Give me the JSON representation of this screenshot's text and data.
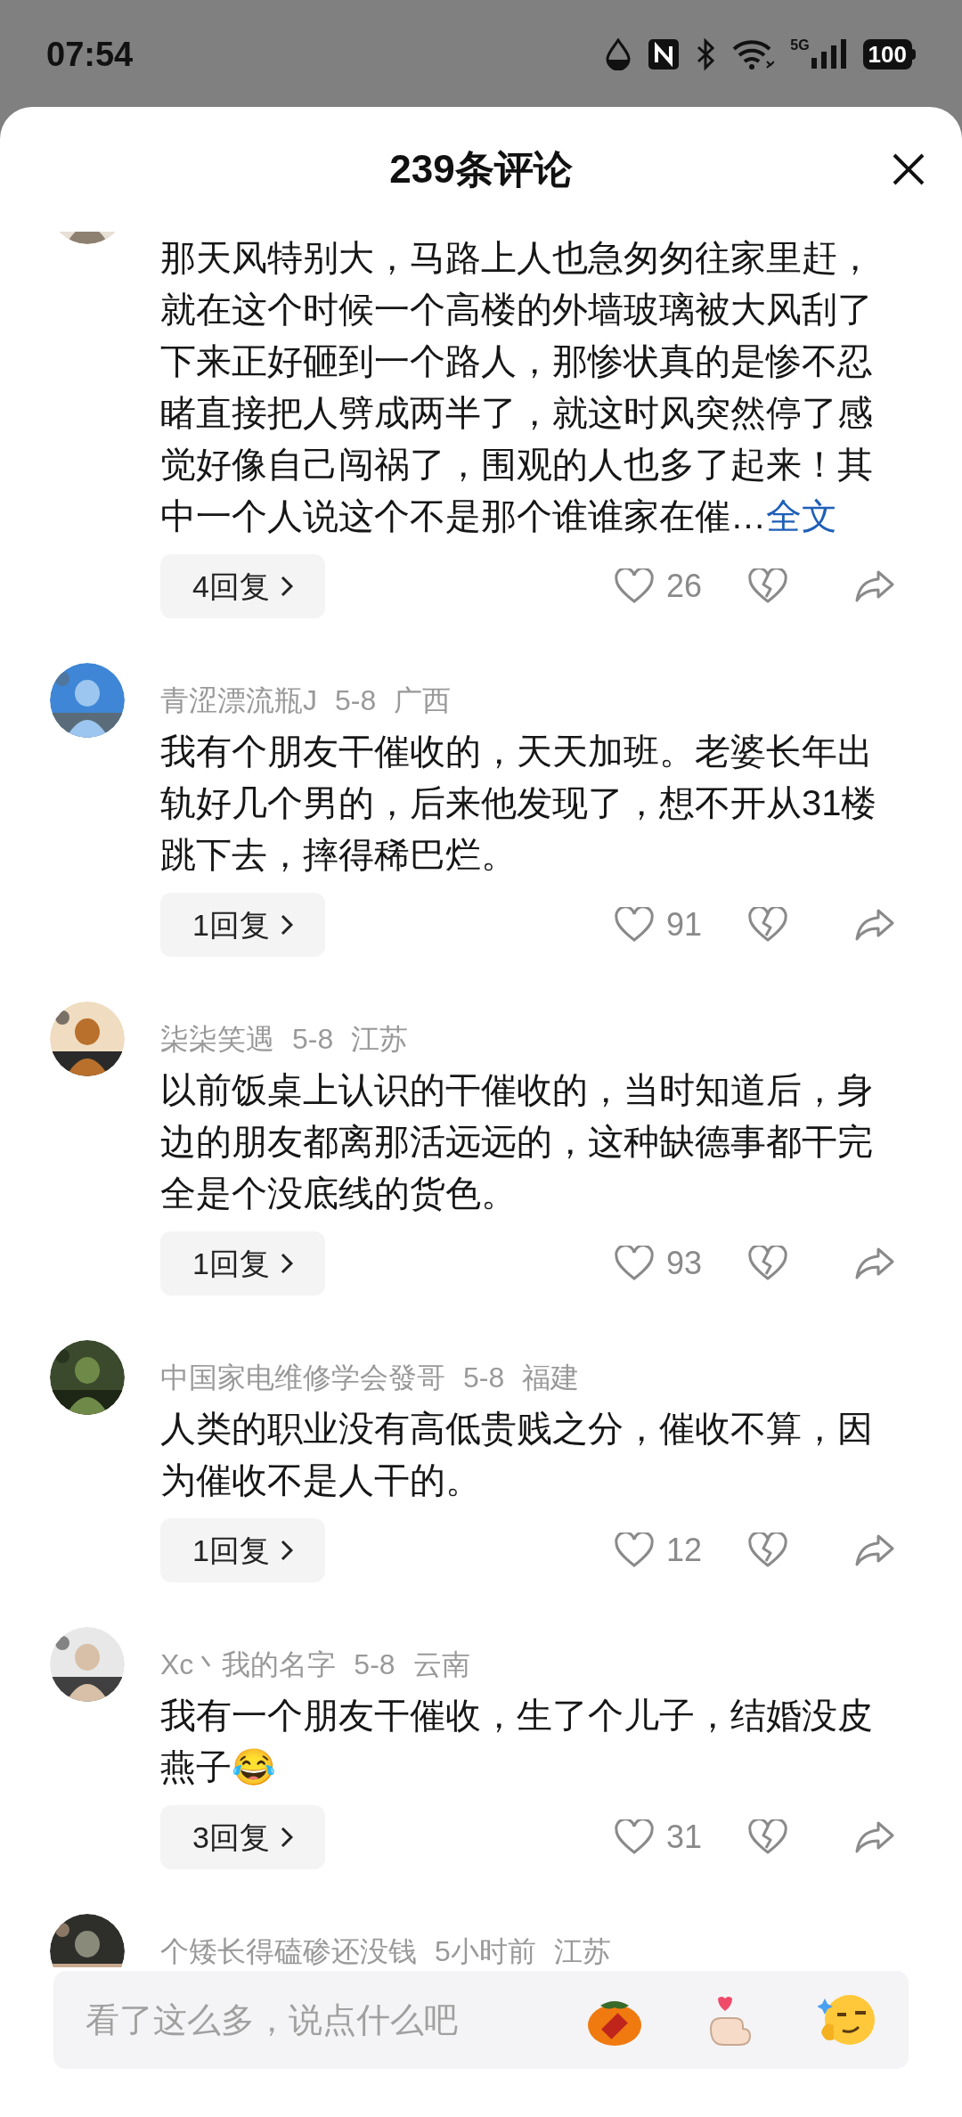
{
  "status_bar": {
    "time": "07:54",
    "network": "5G",
    "battery": "100"
  },
  "header": {
    "title": "239条评论"
  },
  "comments": [
    {
      "text": "那天风特别大，马路上人也急匆匆往家里赶，就在这个时候一个高楼的外墙玻璃被大风刮了下来正好砸到一个路人，那惨状真的是惨不忍睹直接把人劈成两半了，就这时风突然停了感觉好像自己闯祸了，围观的人也多了起来！其中一个人说这个不是那个谁谁家在催…",
      "more_link": "全文",
      "replies": "4回复",
      "likes": "26"
    },
    {
      "author": "青涩漂流瓶J",
      "date": "5-8",
      "region": "广西",
      "text": "我有个朋友干催收的，天天加班。老婆长年出轨好几个男的，后来他发现了，想不开从31楼跳下去，摔得稀巴烂。",
      "replies": "1回复",
      "likes": "91"
    },
    {
      "author": "柒柒笑遇",
      "date": "5-8",
      "region": "江苏",
      "text": "以前饭桌上认识的干催收的，当时知道后，身边的朋友都离那活远远的，这种缺德事都干完全是个没底线的货色。",
      "replies": "1回复",
      "likes": "93"
    },
    {
      "author": "中国家电维修学会發哥",
      "date": "5-8",
      "region": "福建",
      "text": "人类的职业没有高低贵贱之分，催收不算，因为催收不是人干的。",
      "replies": "1回复",
      "likes": "12"
    },
    {
      "author": "Xc丶我的名字",
      "date": "5-8",
      "region": "云南",
      "text": "我有一个朋友干催收，生了个儿子，结婚没皮燕子😂",
      "replies": "3回复",
      "likes": "31"
    },
    {
      "author": "个矮长得磕碜还没钱",
      "date": "5小时前",
      "region": "江苏"
    }
  ],
  "input": {
    "placeholder": "看了这么多，说点什么吧"
  }
}
